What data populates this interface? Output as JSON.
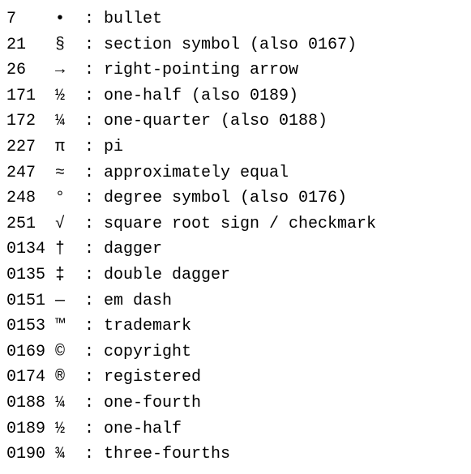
{
  "rows": [
    {
      "code": "7",
      "symbol": "•",
      "sep": " : ",
      "desc": "bullet"
    },
    {
      "code": "21",
      "symbol": "§",
      "sep": " : ",
      "desc": "section symbol (also 0167)"
    },
    {
      "code": "26",
      "symbol": "→",
      "sep": " : ",
      "desc": "right-pointing arrow"
    },
    {
      "code": "171",
      "symbol": "½",
      "sep": " : ",
      "desc": "one-half (also 0189)"
    },
    {
      "code": "172",
      "symbol": "¼",
      "sep": " : ",
      "desc": "one-quarter (also 0188)"
    },
    {
      "code": "227",
      "symbol": "π",
      "sep": " : ",
      "desc": "pi"
    },
    {
      "code": "247",
      "symbol": "≈",
      "sep": " : ",
      "desc": "approximately equal"
    },
    {
      "code": "248",
      "symbol": "°",
      "sep": " : ",
      "desc": "degree symbol (also 0176)"
    },
    {
      "code": "251",
      "symbol": "√",
      "sep": " : ",
      "desc": "square root sign / checkmark"
    },
    {
      "code": "0134",
      "symbol": "†",
      "sep": " : ",
      "desc": "dagger"
    },
    {
      "code": "0135",
      "symbol": "‡",
      "sep": " : ",
      "desc": "double dagger"
    },
    {
      "code": "0151",
      "symbol": "—",
      "sep": " : ",
      "desc": "em dash"
    },
    {
      "code": "0153",
      "symbol": "™",
      "sep": " : ",
      "desc": "trademark"
    },
    {
      "code": "0169",
      "symbol": "©",
      "sep": " : ",
      "desc": "copyright"
    },
    {
      "code": "0174",
      "symbol": "®",
      "sep": " : ",
      "desc": "registered"
    },
    {
      "code": "0188",
      "symbol": "¼",
      "sep": " : ",
      "desc": "one-fourth"
    },
    {
      "code": "0189",
      "symbol": "½",
      "sep": " : ",
      "desc": "one-half"
    },
    {
      "code": "0190",
      "symbol": "¾",
      "sep": " : ",
      "desc": "three-fourths"
    }
  ]
}
